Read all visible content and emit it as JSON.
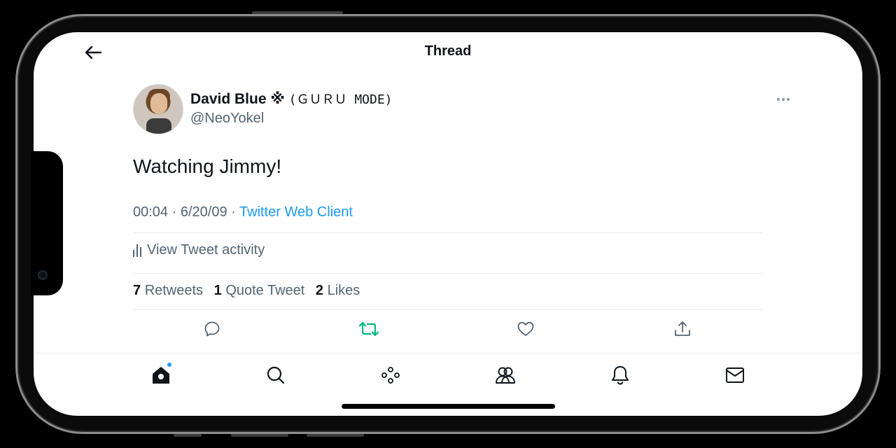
{
  "header": {
    "title": "Thread"
  },
  "tweet": {
    "display_name": "David Blue",
    "name_symbol": "※",
    "name_suffix": "(ＧＵＲＵ MODE)",
    "handle": "@NeoYokel",
    "text": "Watching Jimmy!",
    "time": "00:04",
    "separator_1": "·",
    "date": "6/20/09",
    "separator_2": "·",
    "source": "Twitter Web Client"
  },
  "activity": {
    "label": "View Tweet activity"
  },
  "stats": {
    "retweets_count": "7",
    "retweets_label": "Retweets",
    "quotes_count": "1",
    "quotes_label": "Quote Tweet",
    "likes_count": "2",
    "likes_label": "Likes"
  },
  "actions": {
    "icons": [
      "reply-icon",
      "retweet-icon",
      "like-icon",
      "share-icon"
    ],
    "retweet_active_color": "#00ba7c"
  },
  "nav": {
    "icons": [
      "home-icon",
      "search-icon",
      "spaces-icon",
      "communities-icon",
      "notifications-icon",
      "messages-icon"
    ],
    "home_dot_color": "#1d9bf0"
  },
  "colors": {
    "text_primary": "#0f1419",
    "text_secondary": "#536471",
    "link": "#1d9bf0",
    "divider": "#e6ecf0"
  }
}
